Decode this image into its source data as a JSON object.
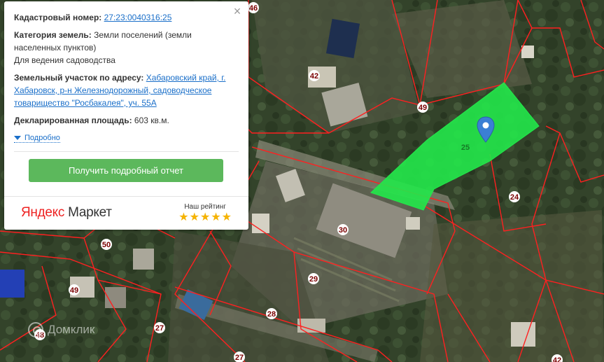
{
  "info": {
    "cadastral_label": "Кадастровый номер:",
    "cadastral_number": "27:23:0040316:25",
    "category_label": "Категория земель:",
    "category_value": "Земли поселений (земли населенных пунктов)",
    "usage": "Для ведения садоводства",
    "address_label": "Земельный участок по адресу:",
    "address_value": "Хабаровский край, г. Хабаровск, р-н Железнодорожный, садоводческое товарищество \"Росбакалея\", уч. 55А",
    "area_label": "Декларированная площадь:",
    "area_value": "603 кв.м.",
    "more_link": "Подробно",
    "report_button": "Получить подробный отчет",
    "close": "×"
  },
  "footer": {
    "logo_part1": "Яндекс",
    "logo_part2": "Маркет",
    "rating_label": "Наш рейтинг",
    "rating_stars": 5
  },
  "map": {
    "parcel_labels": [
      "46",
      "42",
      "49",
      "25",
      "24",
      "30",
      "50",
      "49",
      "29",
      "28",
      "27",
      "27",
      "48",
      "42"
    ],
    "selected_parcel": "25",
    "highlight_color": "#22e84a",
    "boundary_color": "#ff2020"
  },
  "watermark": "Домклик"
}
